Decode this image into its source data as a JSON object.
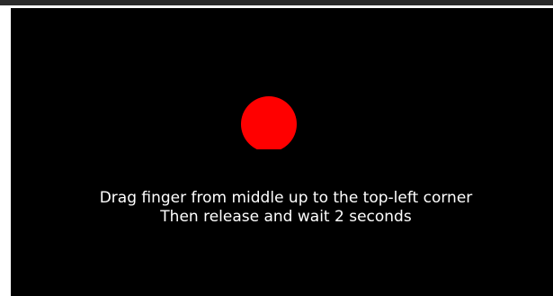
{
  "app": {
    "colors": {
      "background": "#000000",
      "frame": "#ffffff",
      "top_bar": "#2b2b2b",
      "dot": "#ff0000",
      "text": "#ffffff"
    },
    "target_icon": "red-dot-icon"
  },
  "instructions": {
    "line1": "Drag finger from middle up to the top-left corner",
    "line2": "Then release and wait 2 seconds"
  }
}
